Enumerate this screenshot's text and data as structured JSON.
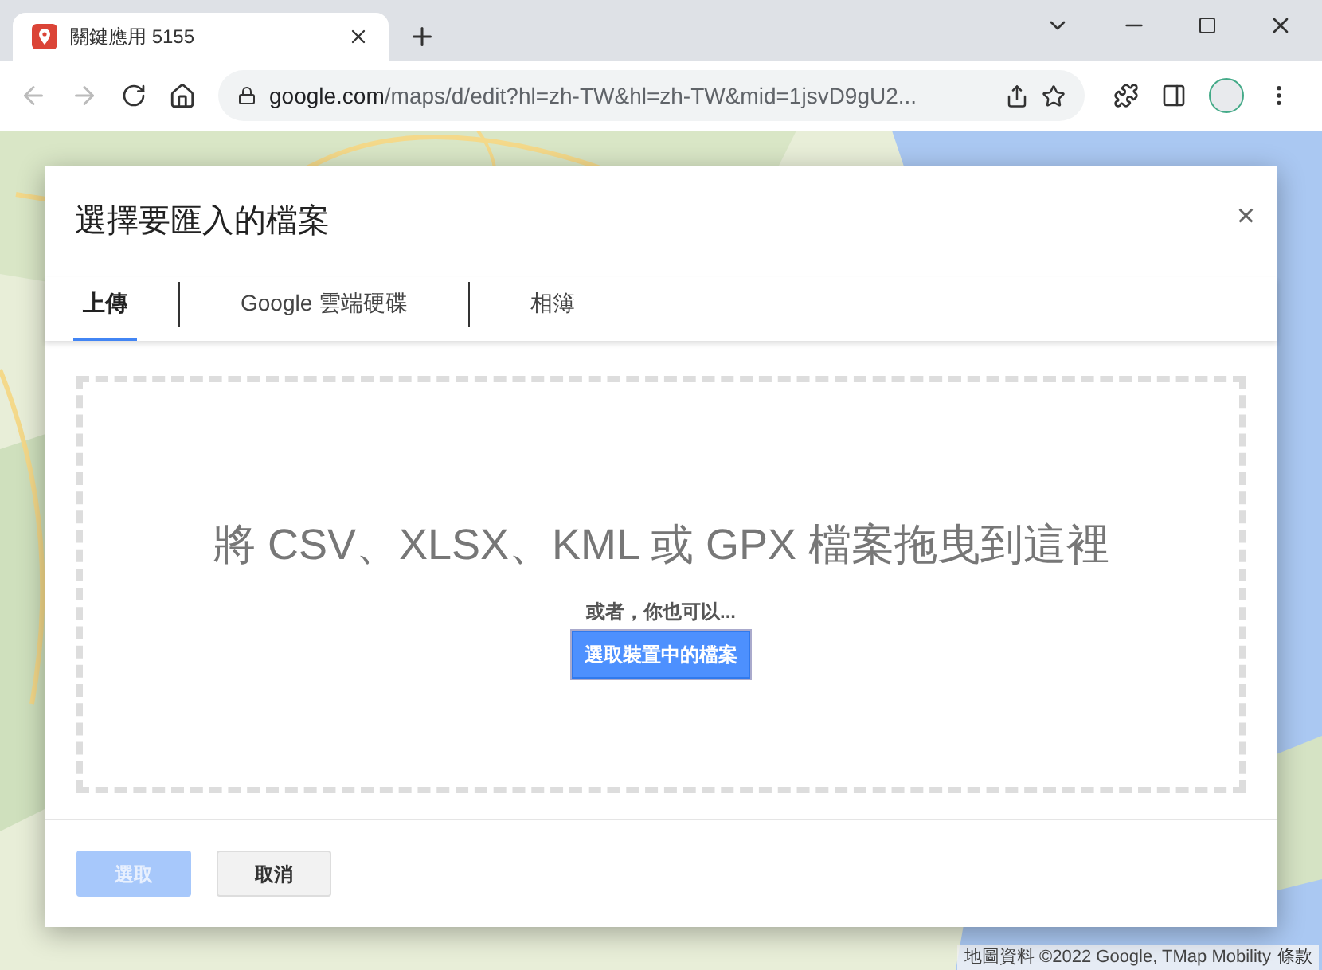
{
  "browser": {
    "tab": {
      "title": "關鍵應用 5155"
    },
    "url": {
      "host": "google.com",
      "path": "/maps/d/edit?hl=zh-TW&hl=zh-TW&mid=1jsvD9gU2..."
    }
  },
  "map": {
    "kind": "picture",
    "attribution": "地圖資料 ©2022 Google, TMap Mobility",
    "terms": "條款"
  },
  "dialog": {
    "title": "選擇要匯入的檔案",
    "close": "×",
    "tabs": [
      {
        "label": "上傳",
        "selected": true
      },
      {
        "label": "Google 雲端硬碟",
        "selected": false
      },
      {
        "label": "相簿",
        "selected": false
      }
    ],
    "drop_zone": {
      "heading": "將 CSV、XLSX、KML 或 GPX 檔案拖曳到這裡",
      "hint": "或者，你也可以...",
      "button": "選取裝置中的檔案"
    },
    "buttons": [
      {
        "label": "選取",
        "kind": "primary",
        "disabled": true
      },
      {
        "label": "取消",
        "kind": "secondary",
        "disabled": false
      }
    ]
  }
}
